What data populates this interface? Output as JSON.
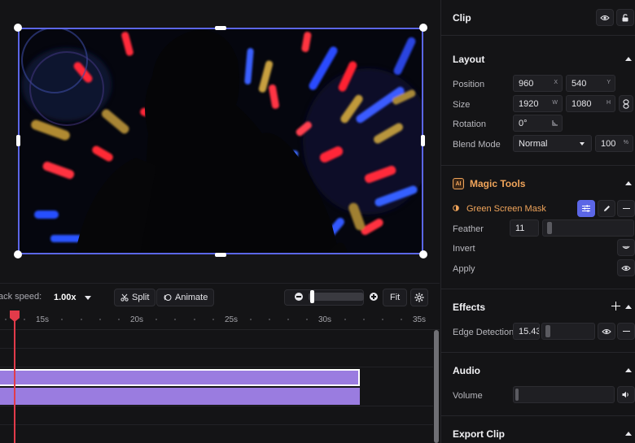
{
  "toolbar": {
    "speed_label": "ack speed:",
    "speed_value": "1.00x",
    "split_label": "Split",
    "animate_label": "Animate",
    "fit_label": "Fit",
    "zoom_level": 0.05
  },
  "timeline": {
    "ticks": [
      "15s",
      "20s",
      "25s",
      "30s",
      "35s"
    ]
  },
  "inspector": {
    "clip_title": "Clip",
    "layout": {
      "title": "Layout",
      "position_label": "Position",
      "position_x": "960",
      "position_x_unit": "X",
      "position_y": "540",
      "position_y_unit": "Y",
      "size_label": "Size",
      "width": "1920",
      "width_unit": "W",
      "height": "1080",
      "height_unit": "H",
      "rotation_label": "Rotation",
      "rotation_value": "0°",
      "blend_label": "Blend Mode",
      "blend_value": "Normal",
      "opacity_value": "100",
      "opacity_unit": "%"
    },
    "magic": {
      "badge": "AI",
      "title": "Magic Tools",
      "mask_label": "Green Screen Mask",
      "feather_label": "Feather",
      "feather_value": "11",
      "invert_label": "Invert",
      "apply_label": "Apply"
    },
    "effects": {
      "title": "Effects",
      "edge_label": "Edge Detection",
      "edge_value": "15.43"
    },
    "audio": {
      "title": "Audio",
      "volume_label": "Volume"
    },
    "export_title": "Export Clip"
  },
  "colors": {
    "accent": "#5b66e6",
    "clip": "#9a7ce0",
    "playhead": "#e23b4a",
    "magic": "#f0a45a"
  }
}
